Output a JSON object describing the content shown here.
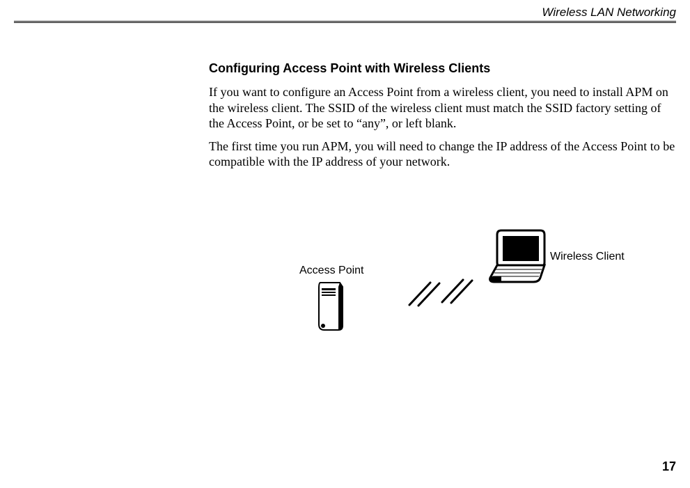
{
  "header": {
    "chapter_title": "Wireless LAN Networking"
  },
  "section": {
    "title": "Configuring Access Point with Wireless Clients",
    "para1": "If you want to configure an Access Point from a wireless client, you need to install APM on the wireless client. The SSID of the wireless client must match the SSID factory setting of the Access Point, or be set to “any”, or left blank.",
    "para2": "The first time you run APM, you will need to change the IP address of the Access Point to be compatible with the IP address of your network."
  },
  "figure": {
    "access_point_label": "Access Point",
    "wireless_client_label": "Wireless Client"
  },
  "footer": {
    "page_number": "17"
  }
}
